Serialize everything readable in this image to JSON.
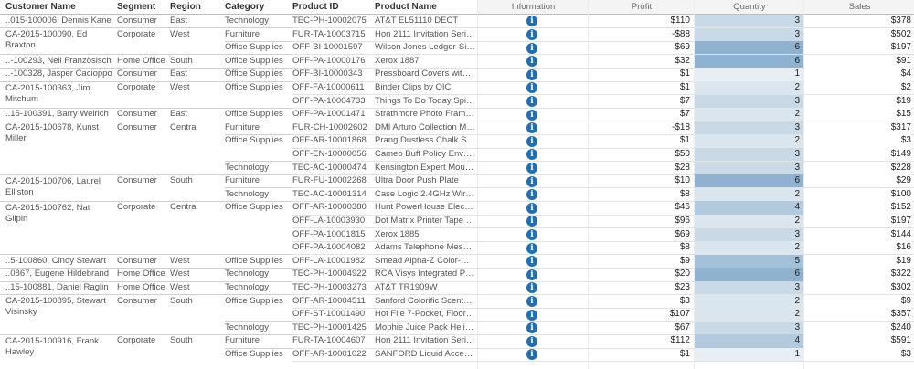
{
  "headers": {
    "customer": "Customer Name",
    "segment": "Segment",
    "region": "Region",
    "category": "Category",
    "product_id": "Product ID",
    "product_name": "Product Name",
    "information": "Information",
    "profit": "Profit",
    "quantity": "Quantity",
    "sales": "Sales"
  },
  "colors": {
    "qty_1": "#e8eef4",
    "qty_2": "#dbe5ee",
    "qty_3": "#c9d9e6",
    "qty_4": "#b2cadd",
    "qty_5": "#a3c1d9",
    "qty_6": "#8fb2d0",
    "info_icon": "#1f6fb5"
  },
  "customers": [
    {
      "text": "..015-100006, Dennis Kane",
      "segment": "Consumer",
      "region": "East",
      "rows": 1
    },
    {
      "text": "CA-2015-100090, Ed Braxton",
      "segment": "Corporate",
      "region": "West",
      "rows": 2
    },
    {
      "text": "..-100293, Neil Französisch",
      "segment": "Home Office",
      "region": "South",
      "rows": 1
    },
    {
      "text": "..-100328, Jasper Cacioppo",
      "segment": "Consumer",
      "region": "East",
      "rows": 1
    },
    {
      "text": "CA-2015-100363, Jim Mitchum",
      "segment": "Corporate",
      "region": "West",
      "rows": 2
    },
    {
      "text": "..15-100391, Barry Weirich",
      "segment": "Consumer",
      "region": "East",
      "rows": 1
    },
    {
      "text": "CA-2015-100678, Kunst Miller",
      "segment": "Consumer",
      "region": "Central",
      "rows": 4
    },
    {
      "text": "CA-2015-100706, Laurel Elliston",
      "segment": "Consumer",
      "region": "South",
      "rows": 2
    },
    {
      "text": "CA-2015-100762, Nat Gilpin",
      "segment": "Corporate",
      "region": "Central",
      "rows": 4
    },
    {
      "text": "..5-100860, Cindy Stewart",
      "segment": "Consumer",
      "region": "West",
      "rows": 1
    },
    {
      "text": "..0867, Eugene Hildebrand",
      "segment": "Home Office",
      "region": "West",
      "rows": 1
    },
    {
      "text": "..15-100881, Daniel Raglin",
      "segment": "Home Office",
      "region": "West",
      "rows": 1
    },
    {
      "text": "CA-2015-100895, Stewart Visinsky",
      "segment": "Consumer",
      "region": "South",
      "rows": 3
    },
    {
      "text": "CA-2015-100916, Frank Hawley",
      "segment": "Corporate",
      "region": "South",
      "rows": 2
    }
  ],
  "rows": [
    {
      "category": "Technology",
      "product_id": "TEC-PH-10002075",
      "product_name": "AT&T EL51110 DECT",
      "profit": "$110",
      "quantity": 3,
      "sales": "$378"
    },
    {
      "category": "Furniture",
      "product_id": "FUR-TA-10003715",
      "product_name": "Hon 2111 Invitation Serie...",
      "profit": "-$88",
      "quantity": 3,
      "sales": "$502"
    },
    {
      "category": "Office Supplies",
      "product_id": "OFF-BI-10001597",
      "product_name": "Wilson Jones Ledger-Size,...",
      "profit": "$69",
      "quantity": 6,
      "sales": "$197"
    },
    {
      "category": "Office Supplies",
      "product_id": "OFF-PA-10000176",
      "product_name": "Xerox 1887",
      "profit": "$32",
      "quantity": 6,
      "sales": "$91"
    },
    {
      "category": "Office Supplies",
      "product_id": "OFF-BI-10000343",
      "product_name": "Pressboard Covers with S...",
      "profit": "$1",
      "quantity": 1,
      "sales": "$4"
    },
    {
      "category": "Office Supplies",
      "product_id": "OFF-FA-10000611",
      "product_name": "Binder Clips by OIC",
      "profit": "$1",
      "quantity": 2,
      "sales": "$2"
    },
    {
      "category": "",
      "product_id": "OFF-PA-10004733",
      "product_name": "Things To Do Today Spiral ...",
      "profit": "$7",
      "quantity": 3,
      "sales": "$19"
    },
    {
      "category": "Office Supplies",
      "product_id": "OFF-PA-10001471",
      "product_name": "Strathmore Photo Frame ...",
      "profit": "$7",
      "quantity": 2,
      "sales": "$15"
    },
    {
      "category": "Furniture",
      "product_id": "FUR-CH-10002602",
      "product_name": "DMI Arturo Collection Mis...",
      "profit": "-$18",
      "quantity": 3,
      "sales": "$317"
    },
    {
      "category": "Office Supplies",
      "product_id": "OFF-AR-10001868",
      "product_name": "Prang Dustless Chalk Stic...",
      "profit": "$1",
      "quantity": 2,
      "sales": "$3"
    },
    {
      "category": "",
      "product_id": "OFF-EN-10000056",
      "product_name": "Cameo Buff Policy Envelo...",
      "profit": "$50",
      "quantity": 3,
      "sales": "$149"
    },
    {
      "category": "Technology",
      "product_id": "TEC-AC-10000474",
      "product_name": "Kensington Expert Mouse ...",
      "profit": "$28",
      "quantity": 3,
      "sales": "$228"
    },
    {
      "category": "Furniture",
      "product_id": "FUR-FU-10002268",
      "product_name": "Ultra Door Push Plate",
      "profit": "$10",
      "quantity": 6,
      "sales": "$29"
    },
    {
      "category": "Technology",
      "product_id": "TEC-AC-10001314",
      "product_name": "Case Logic 2.4GHz Wirele...",
      "profit": "$8",
      "quantity": 2,
      "sales": "$100"
    },
    {
      "category": "Office Supplies",
      "product_id": "OFF-AR-10000380",
      "product_name": "Hunt PowerHouse Electric...",
      "profit": "$46",
      "quantity": 4,
      "sales": "$152"
    },
    {
      "category": "",
      "product_id": "OFF-LA-10003930",
      "product_name": "Dot Matrix Printer Tape R...",
      "profit": "$96",
      "quantity": 2,
      "sales": "$197"
    },
    {
      "category": "",
      "product_id": "OFF-PA-10001815",
      "product_name": "Xerox 1885",
      "profit": "$69",
      "quantity": 3,
      "sales": "$144"
    },
    {
      "category": "",
      "product_id": "OFF-PA-10004082",
      "product_name": "Adams Telephone Messag...",
      "profit": "$8",
      "quantity": 2,
      "sales": "$16"
    },
    {
      "category": "Office Supplies",
      "product_id": "OFF-LA-10001982",
      "product_name": "Smead Alpha-Z Color-Cod...",
      "profit": "$9",
      "quantity": 5,
      "sales": "$19"
    },
    {
      "category": "Technology",
      "product_id": "TEC-PH-10004922",
      "product_name": "RCA Visys Integrated PBX ...",
      "profit": "$20",
      "quantity": 6,
      "sales": "$322"
    },
    {
      "category": "Technology",
      "product_id": "TEC-PH-10003273",
      "product_name": "AT&T TR1909W",
      "profit": "$23",
      "quantity": 3,
      "sales": "$302"
    },
    {
      "category": "Office Supplies",
      "product_id": "OFF-AR-10004511",
      "product_name": "Sanford Colorific Scented ...",
      "profit": "$3",
      "quantity": 2,
      "sales": "$9"
    },
    {
      "category": "",
      "product_id": "OFF-ST-10001490",
      "product_name": "Hot File 7-Pocket, Floor St...",
      "profit": "$107",
      "quantity": 2,
      "sales": "$357"
    },
    {
      "category": "Technology",
      "product_id": "TEC-PH-10001425",
      "product_name": "Mophie Juice Pack Helium...",
      "profit": "$67",
      "quantity": 3,
      "sales": "$240"
    },
    {
      "category": "Furniture",
      "product_id": "FUR-TA-10004607",
      "product_name": "Hon 2111 Invitation Serie...",
      "profit": "$112",
      "quantity": 4,
      "sales": "$591"
    },
    {
      "category": "Office Supplies",
      "product_id": "OFF-AR-10001022",
      "product_name": "SANFORD Liquid Accent T...",
      "profit": "$1",
      "quantity": 1,
      "sales": "$3"
    }
  ]
}
